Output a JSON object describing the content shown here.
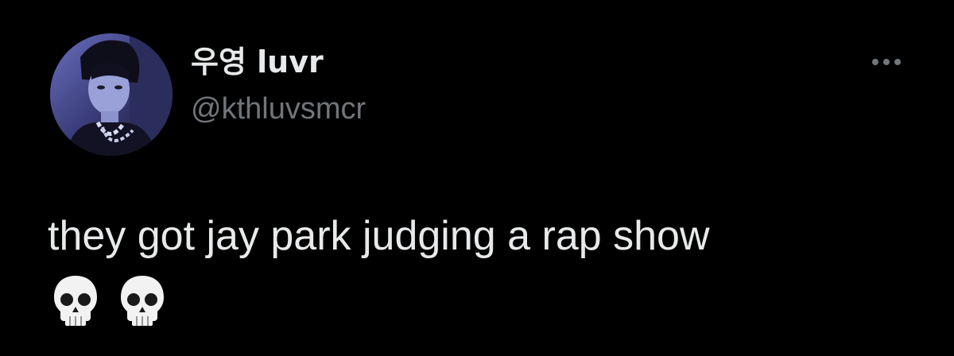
{
  "tweet": {
    "author": {
      "display_name": "우영 luvr",
      "handle": "@kthluvsmcr",
      "avatar_icon": "profile-photo"
    },
    "more_icon": "more-horizontal-icon",
    "text": "they got jay park judging a rap show",
    "emojis": [
      "💀",
      "💀"
    ]
  },
  "colors": {
    "background": "#000000",
    "primary_text": "#e7e9ea",
    "secondary_text": "#71767b"
  }
}
